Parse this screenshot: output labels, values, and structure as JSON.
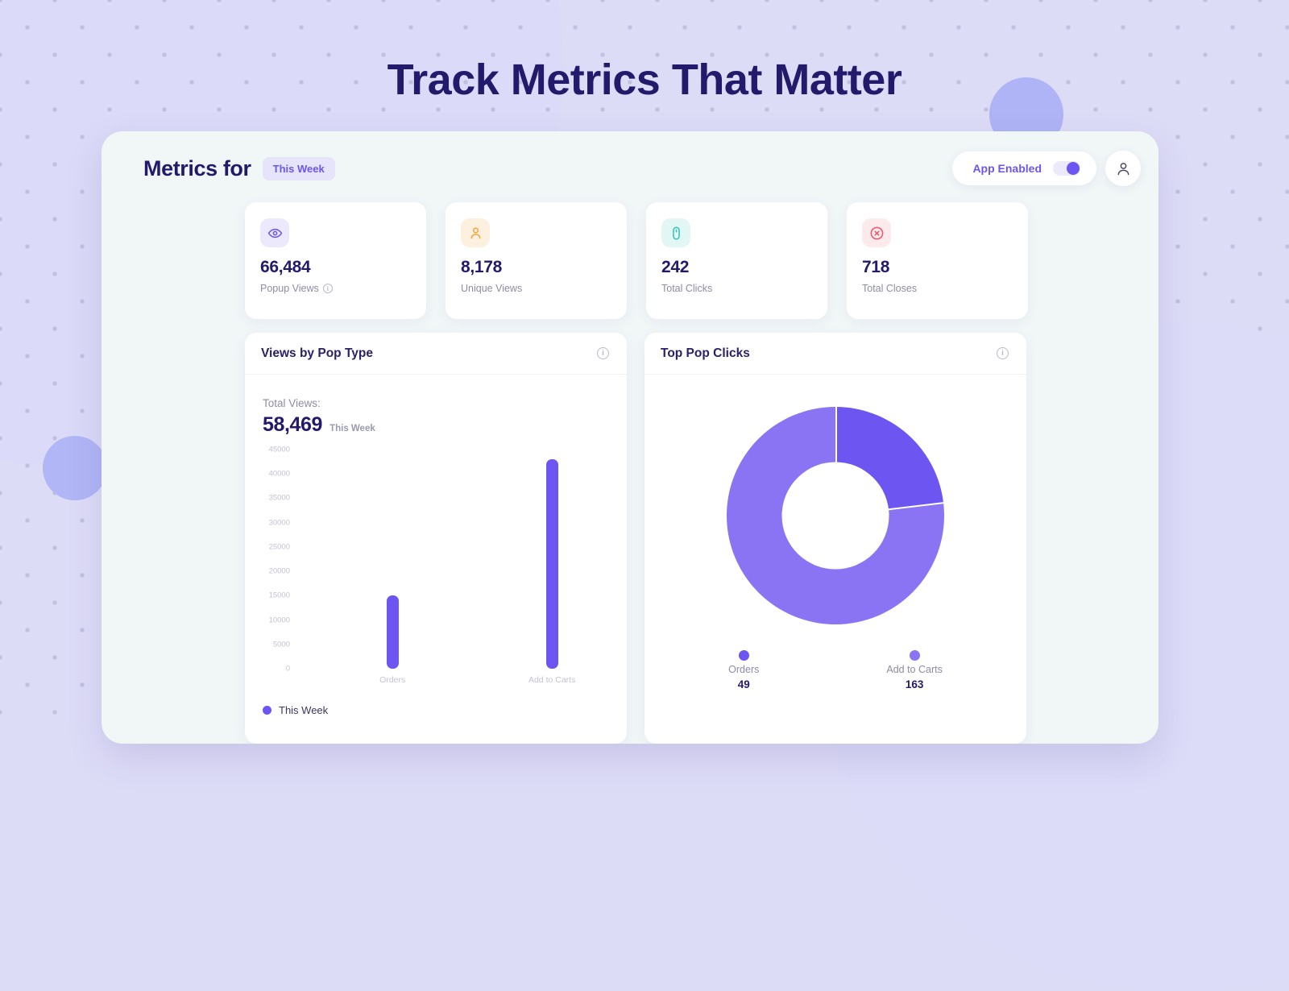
{
  "hero": {
    "title": "Track Metrics That Matter"
  },
  "colors": {
    "accent": "#6c55f0",
    "accent_light": "#8b74f4",
    "title_navy": "#231a6b",
    "page_bg": "#dddcf7",
    "card_bg": "#ffffff",
    "dashboard_bg": "#f1f6f7"
  },
  "dashboard": {
    "title": "Metrics for",
    "period_chip": "This Week",
    "app_toggle": {
      "label": "App Enabled",
      "state": "on"
    },
    "avatar_icon": "user-icon"
  },
  "stats": [
    {
      "icon": "eye-icon",
      "icon_color": "#6c55f0",
      "icon_bg": "#ece9fd",
      "value": "66,484",
      "label": "Popup Views",
      "has_info": true
    },
    {
      "icon": "user-icon",
      "icon_color": "#f5a councillor",
      "value": "8,178",
      "label": "Unique Views",
      "has_info": false
    },
    {
      "icon": "mouse-icon",
      "icon_color": "#2ec4b6",
      "icon_bg": "#e4f7f4",
      "value": "242",
      "label": "Total Clicks",
      "has_info": false
    },
    {
      "icon": "close-circle-icon",
      "icon_color": "#f2556a",
      "icon_bg": "#fdeaec",
      "value": "718",
      "label": "Total Closes",
      "has_info": false
    }
  ],
  "stat_icon_styles": [
    {
      "color": "#6c55f0",
      "bg": "#ece9fd"
    },
    {
      "color": "#f7a23b",
      "bg": "#fdf0df"
    },
    {
      "color": "#2ec4b6",
      "bg": "#e2f6f3"
    },
    {
      "color": "#f2556a",
      "bg": "#fdeaed"
    }
  ],
  "panels": {
    "views": {
      "title": "Views by Pop Type",
      "info_icon": "info-icon",
      "totals_label": "Total Views:",
      "totals_value": "58,469",
      "totals_period": "This Week",
      "legend_label": "This Week"
    },
    "clicks": {
      "title": "Top Pop Clicks",
      "info_icon": "info-icon"
    }
  },
  "chart_data": [
    {
      "type": "bar",
      "title": "Views by Pop Type",
      "subtitle": "Total Views: 58,469 This Week",
      "categories": [
        "Orders",
        "Add to Carts"
      ],
      "series": [
        {
          "name": "This Week",
          "values": [
            15000,
            43000
          ],
          "color": "#6c55f0"
        }
      ],
      "ylabel": "",
      "xlabel": "",
      "ylim": [
        0,
        45000
      ],
      "yticks": [
        45000,
        40000,
        35000,
        30000,
        25000,
        20000,
        15000,
        10000,
        5000,
        0
      ],
      "ytick_labels": [
        "45000",
        "40000",
        "35000",
        "30000",
        "25000",
        "20000",
        "15000",
        "10000",
        "5000",
        "0"
      ],
      "grid": false,
      "legend_position": "bottom-left"
    },
    {
      "type": "pie",
      "title": "Top Pop Clicks",
      "donut": true,
      "labels": [
        "Orders",
        "Add to Carts"
      ],
      "values": [
        49,
        163
      ],
      "colors": [
        "#6c55f0",
        "#8b74f4"
      ],
      "percentages": [
        23.1,
        76.9
      ],
      "legend_position": "bottom"
    }
  ]
}
